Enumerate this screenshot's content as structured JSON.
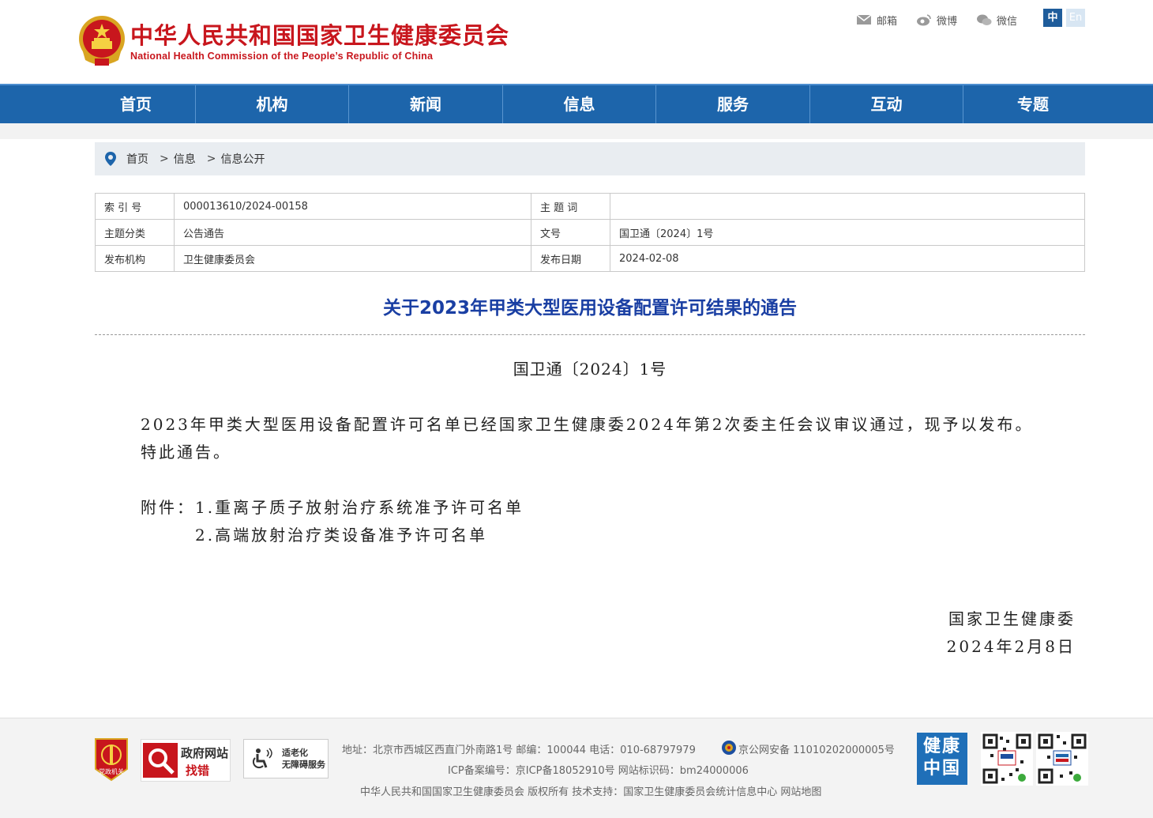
{
  "header": {
    "site_title_cn": "中华人民共和国国家卫生健康委员会",
    "site_title_en": "National Health Commission of the People’s Republic of China",
    "top_links": [
      {
        "label": "邮箱",
        "icon": "mail-icon"
      },
      {
        "label": "微博",
        "icon": "weibo-icon"
      },
      {
        "label": "微信",
        "icon": "wechat-icon"
      }
    ],
    "lang_zh": "中",
    "lang_en": "En"
  },
  "nav": {
    "items": [
      "首页",
      "机构",
      "新闻",
      "信息",
      "服务",
      "互动",
      "专题"
    ]
  },
  "breadcrumb": {
    "items": [
      "首页",
      "信息",
      "信息公开"
    ],
    "separator": ">"
  },
  "meta": {
    "index_no_label": "索 引 号",
    "index_no_value": "000013610/2024-00158",
    "keyword_label": "主 题 词",
    "keyword_value": "",
    "category_label": "主题分类",
    "category_value": "公告通告",
    "doc_no_label": "文号",
    "doc_no_value": "国卫通〔2024〕1号",
    "publisher_label": "发布机构",
    "publisher_value": "卫生健康委员会",
    "date_label": "发布日期",
    "date_value": "2024-02-08"
  },
  "article": {
    "title": "关于2023年甲类大型医用设备配置许可结果的通告",
    "doc_number": "国卫通〔2024〕1号",
    "para1": "2023年甲类大型医用设备配置许可名单已经国家卫生健康委2024年第2次委主任会议审议通过，现予以发布。",
    "para2": "特此通告。",
    "attach1": "附件：1.重离子质子放射治疗系统准予许可名单",
    "attach2": "2.高端放射治疗类设备准予许可名单",
    "sign_org": "国家卫生健康委",
    "sign_date": "2024年2月8日"
  },
  "footer": {
    "party_badge": "党政机关",
    "gov_badge_line1": "政府网站",
    "gov_badge_line2": "找错",
    "age_badge_line1": "适老化",
    "age_badge_line2": "无障碍服务",
    "line1": "地址：北京市西城区西直门外南路1号    邮编：100044    电话：010-68797979",
    "police": "京公网安备 11010202000005号",
    "line2": "ICP备案编号：京ICP备18052910号    网站标识码：bm24000006",
    "line3": "中华人民共和国国家卫生健康委员会    版权所有    技术支持：国家卫生健康委员会统计信息中心  网站地图",
    "health_china": "健康中国"
  },
  "colors": {
    "brand_red": "#c8161d",
    "nav_blue": "#1d65ab",
    "title_blue": "#1a3fa3"
  }
}
